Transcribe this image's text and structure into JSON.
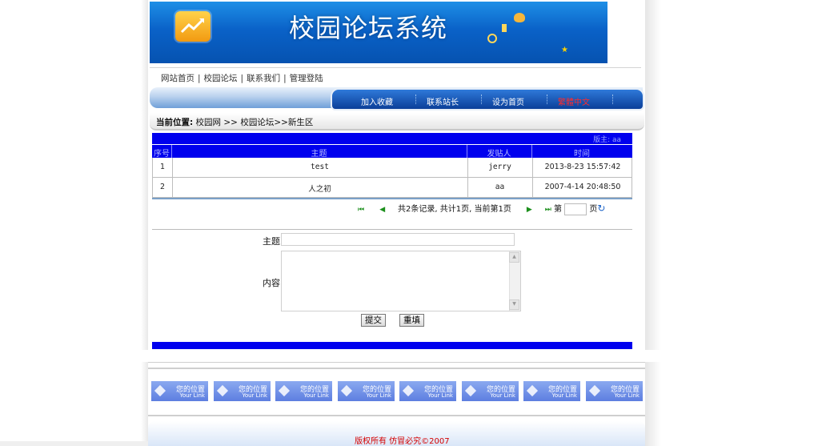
{
  "banner": {
    "title": "校园论坛系统"
  },
  "nav": {
    "top_links": [
      "网站首页",
      "校园论坛",
      "联系我们",
      "管理登陆"
    ],
    "tabs": [
      "加入收藏",
      "联系站长",
      "设为首页",
      "繁體中文"
    ]
  },
  "breadcrumb": {
    "label": "当前位置:",
    "path": "校园网 >> 校园论坛>>新生区"
  },
  "table": {
    "moderator": "版主: aa",
    "headers": [
      "序号",
      "主题",
      "发贴人",
      "时间"
    ],
    "rows": [
      {
        "no": "1",
        "topic": "test",
        "author": "jerry",
        "time": "2013-8-23 15:57:42"
      },
      {
        "no": "2",
        "topic": "人之初",
        "author": "aa",
        "time": "2007-4-14 20:48:50"
      }
    ]
  },
  "pager": {
    "summary": "共2条记录, 共计1页, 当前第1页",
    "goto_prefix": "第",
    "goto_suffix": "页"
  },
  "form": {
    "subject_label": "主题",
    "content_label": "内容",
    "submit": "提交",
    "reset": "重填"
  },
  "footer_links": [
    {
      "label": "您的位置",
      "sub": "Your Link"
    },
    {
      "label": "您的位置",
      "sub": "Your Link"
    },
    {
      "label": "您的位置",
      "sub": "Your Link"
    },
    {
      "label": "您的位置",
      "sub": "Your Link"
    },
    {
      "label": "您的位置",
      "sub": "Your Link"
    },
    {
      "label": "您的位置",
      "sub": "Your Link"
    },
    {
      "label": "您的位置",
      "sub": "Your Link"
    },
    {
      "label": "您的位置",
      "sub": "Your Link"
    }
  ],
  "footer": {
    "copyright": "版权所有 仿冒必究©2007"
  },
  "colors": {
    "header_blue": "#0000ee",
    "banner_blue": "#0a62c8",
    "copyright_red": "#d40000"
  }
}
